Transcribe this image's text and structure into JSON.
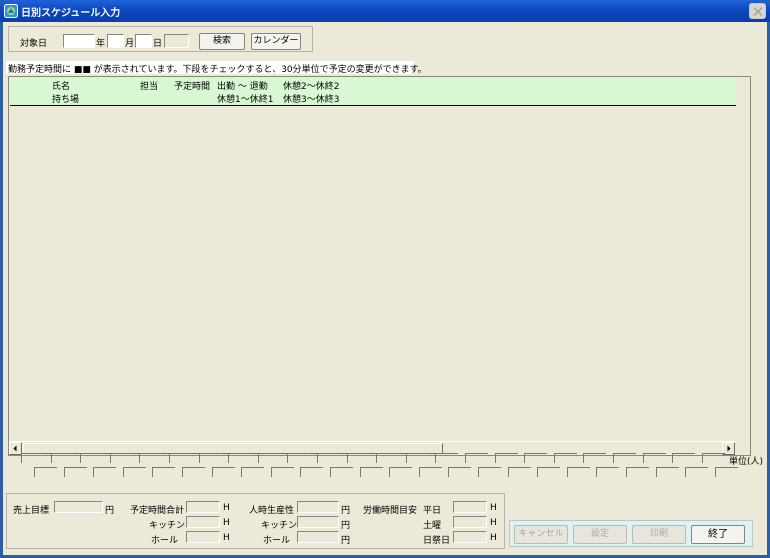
{
  "window": {
    "title": "日別スケジュール入力"
  },
  "search": {
    "date_label": "対象日",
    "year_unit": "年",
    "month_unit": "月",
    "day_unit": "日",
    "search_button": "検索",
    "calendar_button": "カレンダー"
  },
  "notice": "勤務予定時間に ■■ が表示されています。下段をチェックすると、30分単位で予定の変更ができます。",
  "list": {
    "header_row1": [
      "氏名",
      "担当",
      "予定時間",
      "出勤 〜 退勤",
      "休憩2〜休終2"
    ],
    "header_row2": [
      "持ち場",
      "休憩1〜休終1",
      "休憩3〜休終3"
    ]
  },
  "unit_label": "単位(人)",
  "summary": {
    "sales_target_label": "売上目標",
    "sales_target_unit": "円",
    "planned_total_label": "予定時間合計",
    "kitchen_label": "キッチン",
    "hall_label": "ホール",
    "hour_unit": "H",
    "productivity_label": "人時生産性",
    "yen_unit": "円",
    "labor_guide_label": "労働時間目安",
    "weekday_label": "平日",
    "saturday_label": "土曜",
    "holiday_label": "日祭日"
  },
  "buttons": {
    "cancel": "キャンセル",
    "settings": "設定",
    "print": "印刷",
    "exit": "終了"
  },
  "colors": {
    "titlebar": "#0b46bd",
    "client_bg": "#ece9d8",
    "list_header_bg": "#d8f8d4",
    "button_panel_bg": "#dff1f3"
  }
}
